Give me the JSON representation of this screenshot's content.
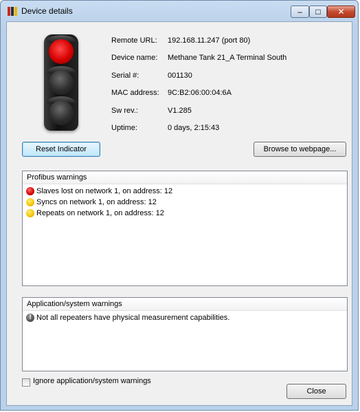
{
  "window": {
    "title": "Device details",
    "minimize_glyph": "–",
    "maximize_glyph": "□",
    "close_glyph": "✕",
    "accent": "#b9d1ea"
  },
  "device": {
    "indicator_state": "red",
    "fields": [
      {
        "label": "Remote URL:",
        "value": "192.168.11.247 (port 80)"
      },
      {
        "label": "Device name:",
        "value": "Methane Tank 21_A Terminal South"
      },
      {
        "label": "Serial #:",
        "value": "001130"
      },
      {
        "label": "MAC address:",
        "value": "9C:B2:06:00:04:6A"
      },
      {
        "label": "Sw rev.:",
        "value": "V1.285"
      },
      {
        "label": "Uptime:",
        "value": "0 days, 2:15:43"
      }
    ]
  },
  "buttons": {
    "reset_indicator": "Reset Indicator",
    "browse": "Browse to webpage...",
    "close": "Close"
  },
  "profibus": {
    "header": "Profibus warnings",
    "items": [
      {
        "severity": "red",
        "text": "Slaves lost on network 1, on address: 12"
      },
      {
        "severity": "yellow",
        "text": "Syncs on network 1, on address: 12"
      },
      {
        "severity": "yellow",
        "text": "Repeats on network 1, on address: 12"
      }
    ]
  },
  "application": {
    "header": "Application/system warnings",
    "items": [
      {
        "severity": "info",
        "icon_glyph": "!",
        "text": "Not all repeaters have physical measurement capabilities."
      }
    ]
  },
  "ignore_checkbox": {
    "label": "Ignore application/system warnings",
    "checked": false
  },
  "colors": {
    "red": "#d60000",
    "yellow": "#f5c400",
    "focus_border": "#3c7fb1"
  }
}
